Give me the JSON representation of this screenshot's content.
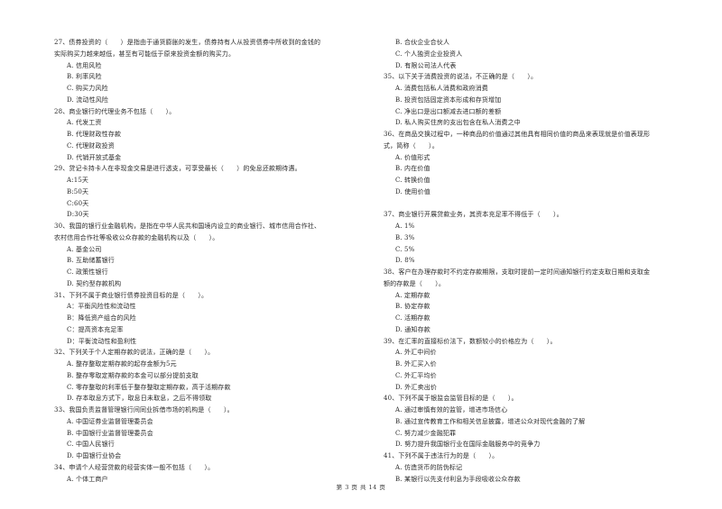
{
  "page": {
    "footer": "第 3 页 共 14 页"
  },
  "left_column": [
    {
      "type": "q",
      "text": "27、债券投资的（　　）是指由于通货膨胀的发生，债券持有人从投资债券中所收到的金钱的"
    },
    {
      "type": "q",
      "text": "实际购买力越来越低，甚至有可能低于原来投资金额的购买力。"
    },
    {
      "type": "o",
      "text": "A. 信用风险"
    },
    {
      "type": "o",
      "text": "B. 利率风险"
    },
    {
      "type": "o",
      "text": "C. 购买力风险"
    },
    {
      "type": "o",
      "text": "D. 流动性风险"
    },
    {
      "type": "q",
      "text": "28、商业银行的代理业务不包括（　　）。"
    },
    {
      "type": "o",
      "text": "A. 代发工资"
    },
    {
      "type": "o",
      "text": "B. 代理财政性存款"
    },
    {
      "type": "o",
      "text": "C. 代理财政投资"
    },
    {
      "type": "o",
      "text": "D. 代销开放式基金"
    },
    {
      "type": "q",
      "text": "29、贷记卡持卡人在非现金交易是进行透支，可享受最长（　　）的免息还款期待遇。"
    },
    {
      "type": "o",
      "text": "A:15天"
    },
    {
      "type": "o",
      "text": "B:50天"
    },
    {
      "type": "o",
      "text": "C:60天"
    },
    {
      "type": "o",
      "text": "D:30天"
    },
    {
      "type": "q",
      "text": "30、我国的银行业金融机构，是指在中华人民共和国境内设立的商业银行、城市信用合作社、"
    },
    {
      "type": "q",
      "text": "农村信用合作社等吸收公众存款的金融机构以及（　　）。"
    },
    {
      "type": "o",
      "text": "A.  基金公司"
    },
    {
      "type": "o",
      "text": "B.  互助储蓄银行"
    },
    {
      "type": "o",
      "text": "C.  政策性银行"
    },
    {
      "type": "o",
      "text": "D.  契约型存款机构"
    },
    {
      "type": "q",
      "text": "31、下列不属于商业银行债券投资目标的是（　　）。"
    },
    {
      "type": "o",
      "text": "A：平衡风险性和流动性"
    },
    {
      "type": "o",
      "text": "B：降低资产组合的风险"
    },
    {
      "type": "o",
      "text": "C：提高资本充足率"
    },
    {
      "type": "o",
      "text": "D：平衡流动性和盈利性"
    },
    {
      "type": "q",
      "text": "32、下列关于个人定期存款的说法，正确的是（　　）。"
    },
    {
      "type": "o",
      "text": "A. 整存整取定期存款的起存金额为5元"
    },
    {
      "type": "o",
      "text": "B. 整存零取定期存款的本金可以部分提前支取"
    },
    {
      "type": "o",
      "text": "C. 零存整取的利率低于整存整取定期存款，高于活期存款"
    },
    {
      "type": "o",
      "text": "D. 存本取息方式下，取息日未取息，之后不得领取"
    },
    {
      "type": "q",
      "text": "33、我国负责监督管理银行间同业拆借市场的机构是（　　）。"
    },
    {
      "type": "o",
      "text": "A. 中国证券业监督管理委员会"
    },
    {
      "type": "o",
      "text": "B. 中国银行业监督管理委员会"
    },
    {
      "type": "o",
      "text": "C. 中国人民银行"
    },
    {
      "type": "o",
      "text": "D. 中国银行业协会"
    },
    {
      "type": "q",
      "text": "34、申请个人经营贷款的经营实体一般不包括（　　）。"
    },
    {
      "type": "o",
      "text": "A. 个体工商户"
    }
  ],
  "right_column": [
    {
      "type": "o",
      "text": "B. 合伙企业合伙人"
    },
    {
      "type": "o",
      "text": "C. 个人独资企业投资人"
    },
    {
      "type": "o",
      "text": "D. 有限公司法人代表"
    },
    {
      "type": "q",
      "text": "35、以下关于消费投资的说法，不正确的是（　　）。"
    },
    {
      "type": "o",
      "text": "A. 消费包括私人消费和政府消费"
    },
    {
      "type": "o",
      "text": "B. 投资包括固定资本形成和存货增加"
    },
    {
      "type": "o",
      "text": "C. 净出口是出口额减去进口额的差额"
    },
    {
      "type": "o",
      "text": "D. 私人购买住房的支出包含在私人消费之中"
    },
    {
      "type": "q",
      "text": "36、在商品交换过程中，一种商品的价值通过其他具有相同价值的商品来表现就是价值表现形"
    },
    {
      "type": "q",
      "text": "式，简称（　　）。"
    },
    {
      "type": "o",
      "text": "A. 价值形式"
    },
    {
      "type": "o",
      "text": "B. 内在价值"
    },
    {
      "type": "o",
      "text": "C. 转换价值"
    },
    {
      "type": "o",
      "text": "D. 使用价值"
    },
    {
      "type": "gap",
      "text": ""
    },
    {
      "type": "q",
      "text": "37、商业银行开展贷款业务，其资本充足率不得低于（　　）。"
    },
    {
      "type": "o",
      "text": "A. 1%"
    },
    {
      "type": "o",
      "text": "B. 3%"
    },
    {
      "type": "o",
      "text": "C. 5%"
    },
    {
      "type": "o",
      "text": "D. 8%"
    },
    {
      "type": "q",
      "text": "38、客户在办理存款时不约定存款期限，支取时提前一定时间通知银行约定支取日期和支取金"
    },
    {
      "type": "q",
      "text": "额的存款是（　　）。"
    },
    {
      "type": "o",
      "text": "A. 定期存款"
    },
    {
      "type": "o",
      "text": "B. 协定存款"
    },
    {
      "type": "o",
      "text": "C. 活期存款"
    },
    {
      "type": "o",
      "text": "D. 通知存款"
    },
    {
      "type": "q",
      "text": "39、在汇率的直接标价法下，数额较小的价格应为（　　）。"
    },
    {
      "type": "o",
      "text": "A. 外汇中间价"
    },
    {
      "type": "o",
      "text": "B. 外汇买入价"
    },
    {
      "type": "o",
      "text": "C. 外汇平均价"
    },
    {
      "type": "o",
      "text": "D. 外汇卖出价"
    },
    {
      "type": "q",
      "text": "40、下列不属于银监会监管目标的是（　　）。"
    },
    {
      "type": "o",
      "text": "A. 通过审慎有效的监管，增进市场信心"
    },
    {
      "type": "o",
      "text": "B. 通过宣传教育工作和相关信息披露，增进公众对现代金融的了解"
    },
    {
      "type": "o",
      "text": "C. 努力减少金融犯罪"
    },
    {
      "type": "o",
      "text": "D. 努力提升我国银行业在国际金融服务中的竞争力"
    },
    {
      "type": "q",
      "text": "41、下列不属于违法行为的是（　　）。"
    },
    {
      "type": "o",
      "text": "A.  仿造货币的防伪标记"
    },
    {
      "type": "o",
      "text": "B.  某银行以先支付利息为手段吸收公众存款"
    }
  ]
}
